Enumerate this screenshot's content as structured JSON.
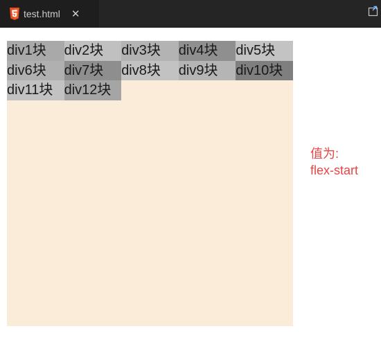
{
  "tab": {
    "label": "test.html",
    "icon": "html5-icon",
    "close_symbol": "✕"
  },
  "toolbar": {
    "open_changes_icon": "open-changes-icon"
  },
  "container": {
    "background": "#fbebd9",
    "items": [
      {
        "text": "div1块",
        "color": "#a9a9a9"
      },
      {
        "text": "div2块",
        "color": "#c0c0c0"
      },
      {
        "text": "div3块",
        "color": "#b3b3b3"
      },
      {
        "text": "div4块",
        "color": "#8f8f8f"
      },
      {
        "text": "div5块",
        "color": "#c3c3c3"
      },
      {
        "text": "div6块",
        "color": "#b0b0b0"
      },
      {
        "text": "div7块",
        "color": "#8e8e8e"
      },
      {
        "text": "div8块",
        "color": "#c2c2c2"
      },
      {
        "text": "div9块",
        "color": "#b5b5b5"
      },
      {
        "text": "div10块",
        "color": "#7f7f7f"
      },
      {
        "text": "div11块",
        "color": "#c2c2c2"
      },
      {
        "text": "div12块",
        "color": "#a5a5a5"
      }
    ]
  },
  "note": {
    "line1": "值为:",
    "line2": "flex-start",
    "color": "#e64545"
  }
}
